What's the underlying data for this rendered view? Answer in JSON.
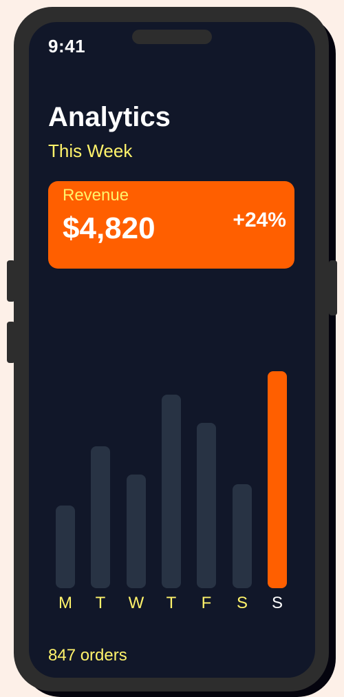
{
  "status_bar": {
    "time": "9:41"
  },
  "header": {
    "title": "Analytics",
    "subtitle": "This Week"
  },
  "revenue_card": {
    "label": "Revenue",
    "value": "$4,820",
    "change": "+24%"
  },
  "chart_data": {
    "type": "bar",
    "categories": [
      "M",
      "T",
      "W",
      "T",
      "F",
      "S",
      "S"
    ],
    "values": [
      120,
      206,
      165,
      281,
      240,
      151,
      315
    ],
    "highlight_index": 6,
    "ylim": [
      0,
      315
    ],
    "grid": false,
    "colors": {
      "bar": "#283344",
      "highlight": "#ff5f00",
      "label": "#fff36b",
      "highlight_label": "#ffffff"
    }
  },
  "footer": {
    "orders": "847 orders"
  },
  "colors": {
    "background": "#111729",
    "accent": "#ff5f00",
    "subtitle": "#fff36b",
    "text": "#ffffff",
    "frame": "#2d2d2d",
    "page": "#fdf0e8"
  }
}
